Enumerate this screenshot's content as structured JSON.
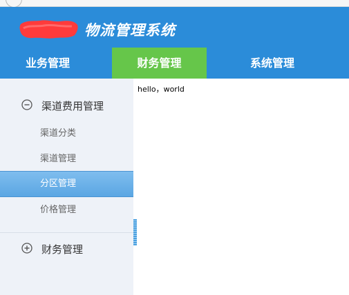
{
  "header": {
    "title": "物流管理系统"
  },
  "nav": {
    "tabs": [
      {
        "label": "业务管理"
      },
      {
        "label": "财务管理"
      },
      {
        "label": "系统管理"
      }
    ],
    "active_color": "#66c64a",
    "bar_color": "#2b8cd9"
  },
  "sidebar": {
    "groups": [
      {
        "label": "渠道费用管理",
        "expanded": true,
        "icon": "minus-circle-icon",
        "items": [
          {
            "label": "渠道分类"
          },
          {
            "label": "渠道管理"
          },
          {
            "label": "分区管理"
          },
          {
            "label": "价格管理"
          }
        ]
      },
      {
        "label": "财务管理",
        "expanded": false,
        "icon": "plus-circle-icon"
      }
    ],
    "active_item": "分区管理"
  },
  "main": {
    "content": "hello，world"
  }
}
